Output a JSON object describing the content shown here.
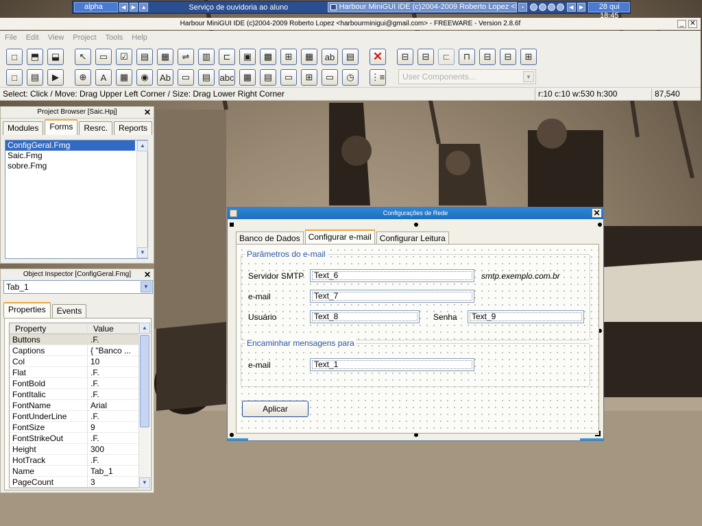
{
  "taskbar": {
    "alpha": "alpha",
    "task1": "Serviço de ouvidoria ao aluno",
    "task2": "Harbour MiniGUI IDE (c)2004-2009 Roberto Lopez <ha...",
    "clock": "28 qui 18:45"
  },
  "ide": {
    "title": "Harbour MiniGUI IDE (c)2004-2009 Roberto Lopez <harbourminigui@gmail.com> - FREEWARE - Version 2.8.6f",
    "min": "_",
    "close": "✕"
  },
  "menu": [
    "File",
    "Edit",
    "View",
    "Project",
    "Tools",
    "Help"
  ],
  "toolbar": {
    "user_components": "User Components...",
    "row1": [
      "□",
      "⬒",
      "⬓",
      "↖",
      "▭",
      "☑",
      "▤",
      "▦",
      "⇌",
      "▥",
      "⊏",
      "▣",
      "▩",
      "⊞",
      "▦",
      "ab",
      "▤",
      "✕",
      "⊟",
      "⊟",
      "⊏",
      "⊓",
      "⊟",
      "⊟",
      "⊞"
    ],
    "row2": [
      "□",
      "▤",
      "▶",
      "⊕",
      "A",
      "▦",
      "◉",
      "Ab",
      "▭",
      "▤",
      "abc",
      "▦",
      "▤",
      "▭",
      "⊞",
      "▭",
      "◷",
      "⋮≡"
    ]
  },
  "status": {
    "main": "Select: Click / Move: Drag Upper Left Corner / Size: Drag Lower Right Corner",
    "geometry": "r:10 c:10 w:530 h:300",
    "position": "87,540"
  },
  "project_browser": {
    "title": "Project Browser [Saic.Hpj]",
    "close": "✕",
    "tabs": [
      "Modules",
      "Forms",
      "Resrc.",
      "Reports"
    ],
    "files": [
      "ConfigGeral.Fmg",
      "Saic.Fmg",
      "sobre.Fmg"
    ]
  },
  "object_inspector": {
    "title": "Object Inspector [ConfigGeral.Fmg]",
    "close": "✕",
    "selected": "Tab_1",
    "tabs": [
      "Properties",
      "Events"
    ],
    "col_property": "Property",
    "col_value": "Value",
    "rows": [
      {
        "p": "Buttons",
        "v": ".F."
      },
      {
        "p": "Captions",
        "v": "{ \"Banco ..."
      },
      {
        "p": "Col",
        "v": "10"
      },
      {
        "p": "Flat",
        "v": ".F."
      },
      {
        "p": "FontBold",
        "v": ".F."
      },
      {
        "p": "FontItalic",
        "v": ".F."
      },
      {
        "p": "FontName",
        "v": "Arial"
      },
      {
        "p": "FontUnderLine",
        "v": ".F."
      },
      {
        "p": "FontSize",
        "v": "9"
      },
      {
        "p": "FontStrikeOut",
        "v": ".F."
      },
      {
        "p": "Height",
        "v": "300"
      },
      {
        "p": "HotTrack",
        "v": ".F."
      },
      {
        "p": "Name",
        "v": "Tab_1"
      },
      {
        "p": "PageCount",
        "v": "3"
      }
    ]
  },
  "form": {
    "title": "Configurações de Rede",
    "close": "✕",
    "tabs": [
      "Banco de Dados",
      "Configurar e-mail",
      "Configurar Leitura"
    ],
    "frame1_title": "Parâmetros do e-mail",
    "lbl_smtp": "Servidor SMTP",
    "txt6": "Text_6",
    "smtp_hint": "smtp.exemplo.com.br",
    "lbl_email": "e-mail",
    "txt7": "Text_7",
    "lbl_usuario": "Usuário",
    "txt8": "Text_8",
    "lbl_senha": "Senha",
    "txt9": "Text_9",
    "frame2_title": "Encaminhar mensagens para",
    "lbl_email2": "e-mail",
    "txt1": "Text_1",
    "apply": "Aplicar"
  },
  "colors": {
    "accent": "#316ac5",
    "form_title": "#1d6fc2",
    "tab_highlight": "#f2a33a"
  }
}
